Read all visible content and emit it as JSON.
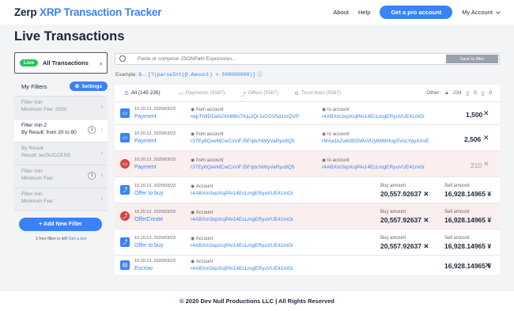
{
  "header": {
    "logo_zerp": "Zerp",
    "logo_xrp": "XRP",
    "logo_rest": "Transaction Tracker",
    "nav": {
      "about": "About",
      "help": "Help",
      "get_pro": "Get a pro account",
      "account": "My Account"
    }
  },
  "page_title": "Live Transactions",
  "sidebar": {
    "live_badge": "Live",
    "all_transactions": "All Transactions",
    "my_filters": "My Filters",
    "settings": "Settings",
    "filters": [
      {
        "name": "Filter min",
        "desc": "Minimum Fee: 2000"
      },
      {
        "name": "Filter min 2",
        "desc": "By Result: from 20 to 60",
        "count": "1"
      },
      {
        "name": "By Result",
        "desc": "Result: tecSUCCESS"
      },
      {
        "name": "Filter min",
        "desc": "Minimum Fee:",
        "count": "3"
      },
      {
        "name": "Filter min",
        "desc": "Minimum Fee:"
      }
    ],
    "add_filter": "+ Add New Filter",
    "note": "1 free filter is left",
    "note_link": "Get a pro"
  },
  "search": {
    "placeholder": "Paste or compose JSONPath Expression...",
    "save": "Save to filter"
  },
  "example": {
    "label": "Example:",
    "code": "$..[?(parseInt(@.Amount) > 500000000)]"
  },
  "tabs": [
    {
      "label": "All (145 235)"
    },
    {
      "label": "Payments (5587)"
    },
    {
      "label": "Offers (5587)"
    },
    {
      "label": "Trust lines (5587)"
    }
  ],
  "other": {
    "label": "Other:",
    "c1": "234",
    "c2": "0",
    "c3": "0"
  },
  "rows": [
    {
      "date": "10.20.12, 2020/03/23",
      "type": "Payment",
      "l1": "from account",
      "v1": "rwpTh9DDa52XkM9nTKju2QrJuCGV5d1mQVP",
      "l2": "to account",
      "v2": "r4ABXm3xpXojPAi14EcLmgERyuVUE41mGi",
      "amount": "1,500"
    },
    {
      "date": "10.20.12, 2020/03/23",
      "type": "Payment",
      "l1": "from account",
      "v1": "r37Ey6QxeMCwCsViFJ5FqbcNWyVaRyo8Q5",
      "l2": "to account",
      "v2": "rMAa1kZwK85SWuVUy8M8HugSVoLYpyAXvE",
      "amount": "2,506"
    },
    {
      "date": "10.20.12, 2020/03/23",
      "type": "Payment",
      "l1": "from account",
      "v1": "r37Ey6QxeMCwCsViFJ5FqbcNWyVaRyo8Q5",
      "l2": "to account",
      "v2": "r4ABXm3xpXojPAi14EcLmgERyuVUE41mGi",
      "amount": "210"
    },
    {
      "date": "10.20.12, 2020/03/23",
      "type": "Offer to buy",
      "l1": "Account",
      "v1": "r4ABXm3xpXojPAi14EcLmgERyuVUE41mGi",
      "buy_lbl": "Buy amount",
      "buy": "20,557.92637",
      "sell_lbl": "Sell amount",
      "sell": "16,928.14965 ¥"
    },
    {
      "date": "10.20.12, 2020/03/23",
      "type": "OfferCreate",
      "l1": "Account",
      "v1": "r4ABXm3xpXojPAi14EcLmgERyuVUE41mGi",
      "buy_lbl": "Buy amount",
      "buy": "20,557.92637",
      "sell_lbl": "Sell amount",
      "sell": "16,928.14965 ¥"
    },
    {
      "date": "10.20.12, 2020/03/23",
      "type": "Offer to buy",
      "l1": "Account",
      "v1": "r4ABXm3xpXojPAi14EcLmgERyuVUE41mGi",
      "buy_lbl": "Buy amount",
      "buy": "20,557.92637",
      "sell_lbl": "Sell amount",
      "sell": "16,928.14965 ¥"
    },
    {
      "date": "10.20.12, 2020/03/23",
      "type": "Escrow",
      "l1": "Account",
      "v1": "r4ABXm3xpXojPAi14EcLmgERyuVUE41mGi",
      "amount": "16,928.14965 ¥"
    }
  ],
  "footer": "© 2020 Dev Null Productions LLC | All Rights Reserved"
}
